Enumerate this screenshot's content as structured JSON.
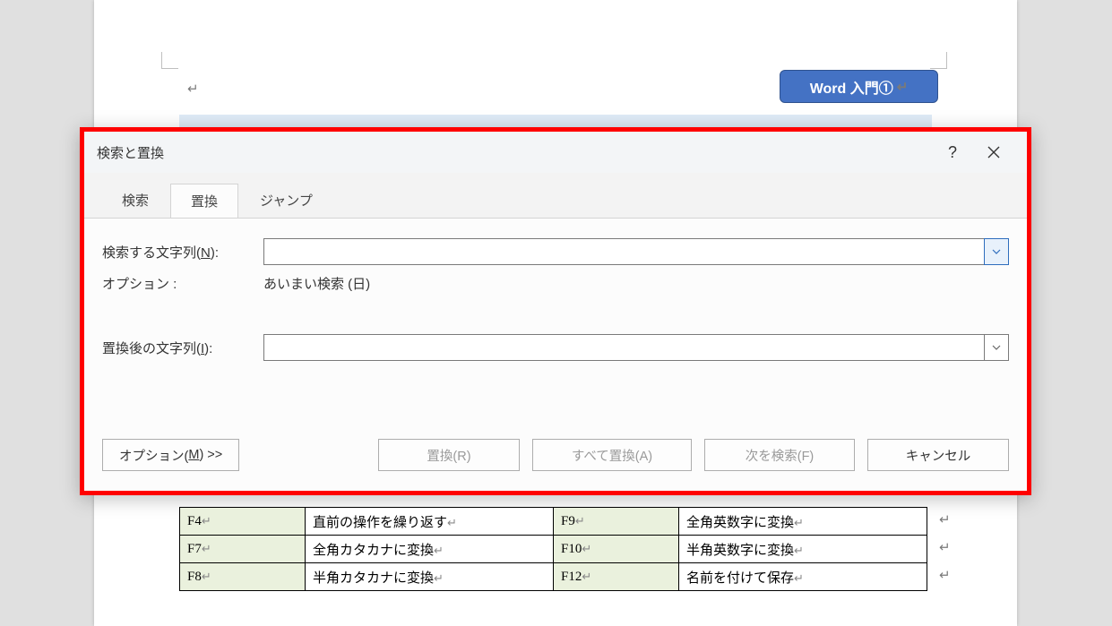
{
  "document": {
    "title_box": "Word 入門①"
  },
  "dialog": {
    "title": "検索と置換",
    "help": "?",
    "close": "✕",
    "tabs": {
      "search": "検索",
      "replace": "置換",
      "jump": "ジャンプ"
    },
    "find_label_pre": "検索する文字列(",
    "find_accel": "N",
    "find_label_post": "):",
    "find_value": "",
    "option_label": "オプション :",
    "option_value": "あいまい検索 (日)",
    "replace_label_pre": "置換後の文字列(",
    "replace_accel": "I",
    "replace_label_post": "):",
    "replace_value": "",
    "buttons": {
      "more_pre": "オプション(",
      "more_accel": "M",
      "more_post": ") >>",
      "replace": "置換(R)",
      "replace_all": "すべて置換(A)",
      "find_next": "次を検索(F)",
      "cancel": "キャンセル"
    }
  },
  "shortcuts": {
    "rows": [
      {
        "k1": "F4",
        "d1": "直前の操作を繰り返す",
        "k2": "F9",
        "d2": "全角英数字に変換"
      },
      {
        "k1": "F7",
        "d1": "全角カタカナに変換",
        "k2": "F10",
        "d2": "半角英数字に変換"
      },
      {
        "k1": "F8",
        "d1": "半角カタカナに変換",
        "k2": "F12",
        "d2": "名前を付けて保存"
      }
    ]
  }
}
